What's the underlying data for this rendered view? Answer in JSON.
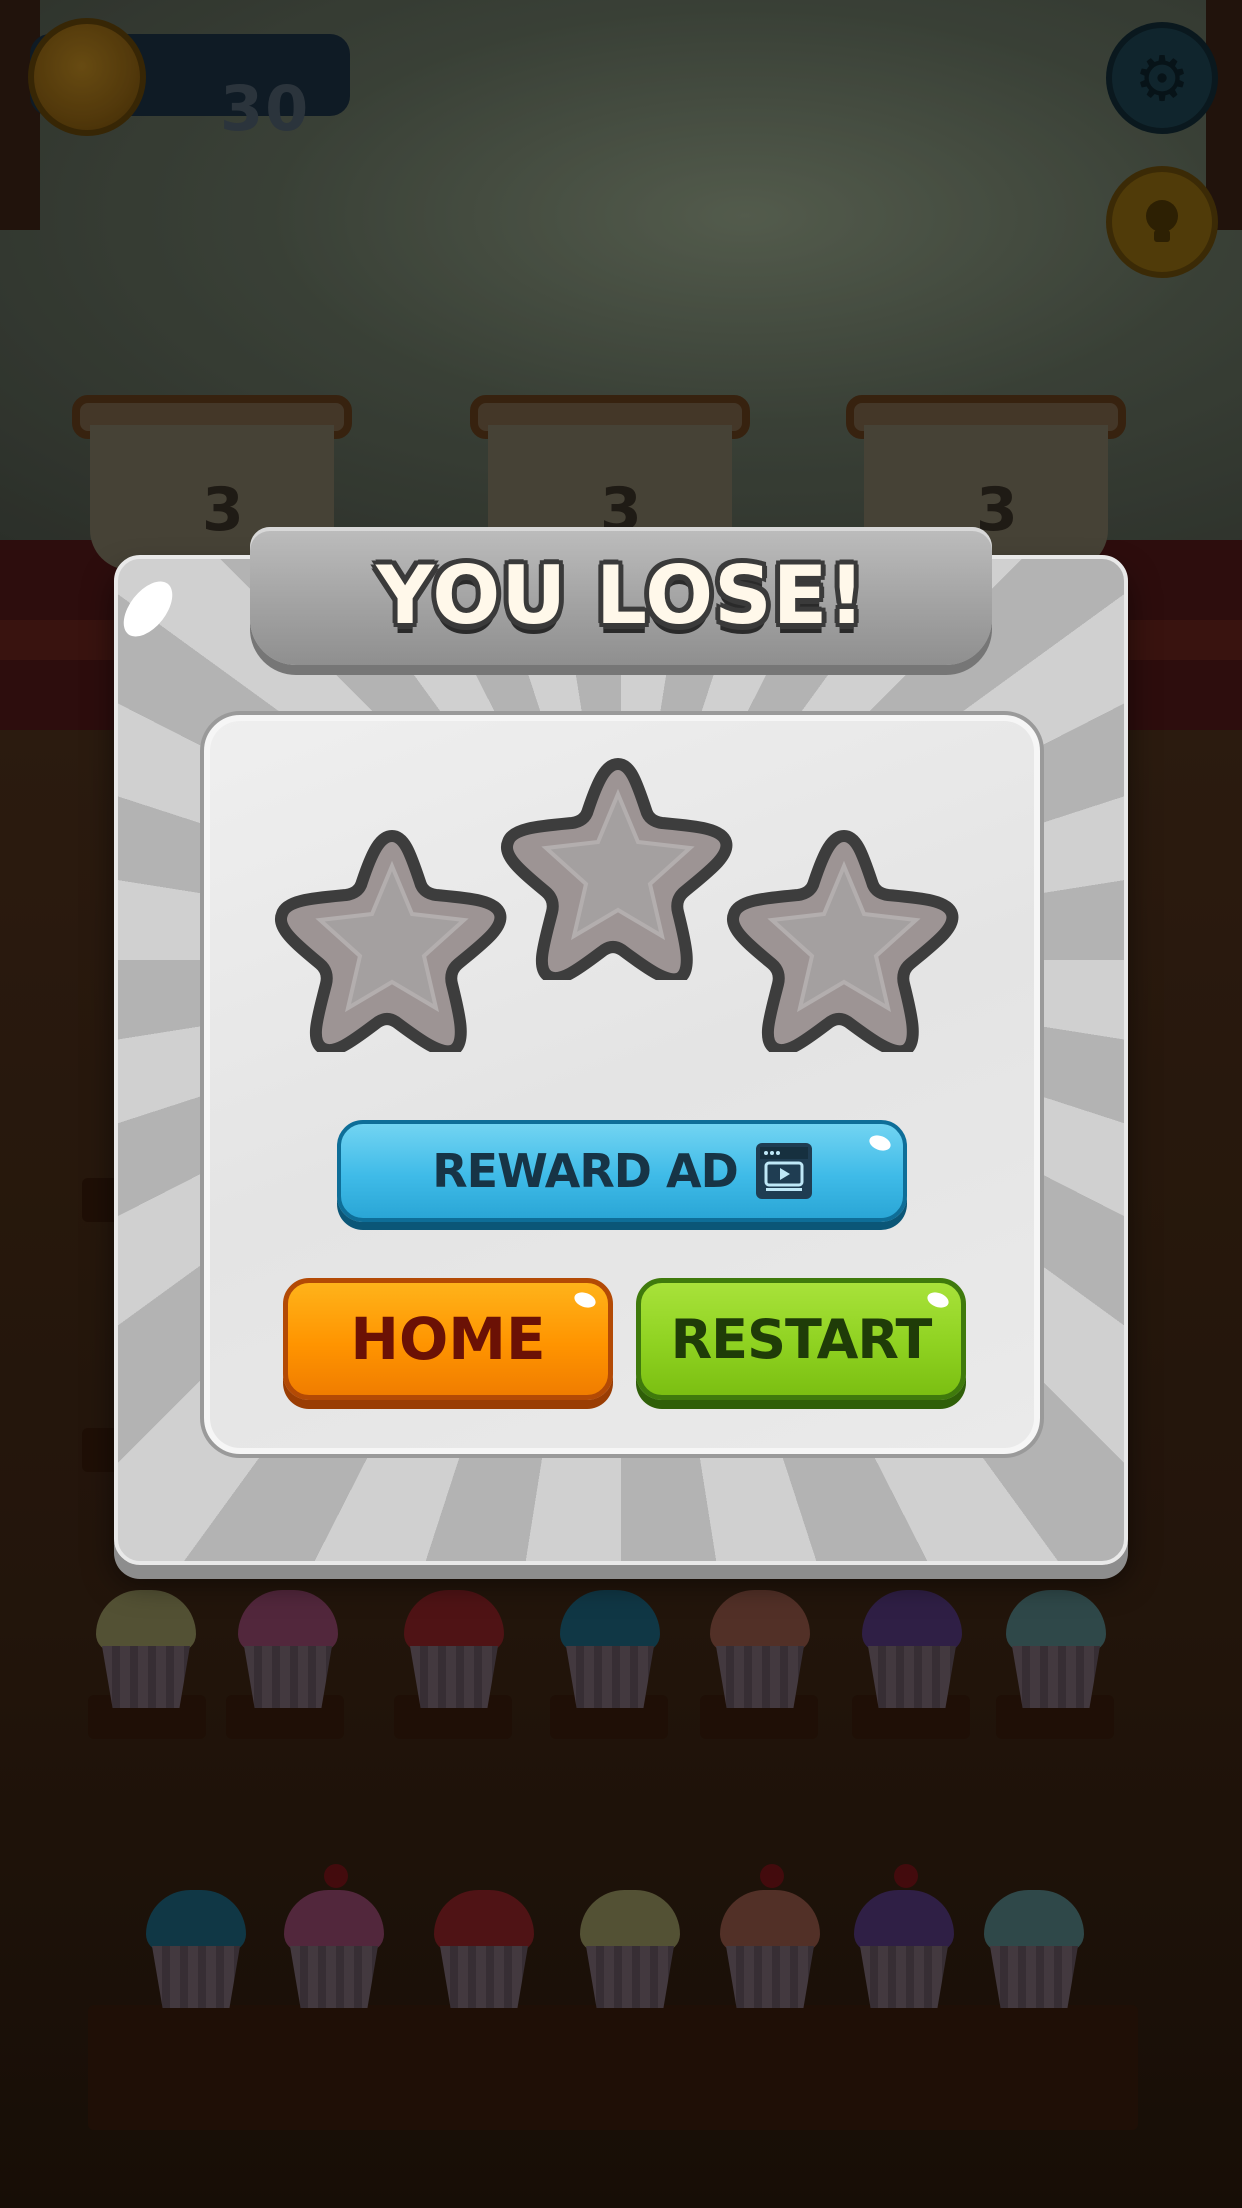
{
  "hud": {
    "coins": "30",
    "settings_icon": "gear-icon",
    "hint_icon": "lightbulb-icon"
  },
  "baskets": [
    {
      "count": "3"
    },
    {
      "count": "3"
    },
    {
      "count": "3"
    }
  ],
  "dialog": {
    "title": "YOU LOSE!",
    "stars_earned": 0,
    "stars_total": 3,
    "reward_button": {
      "label": "REWARD AD",
      "icon": "video-ad-icon"
    },
    "home_button": {
      "label": "HOME"
    },
    "restart_button": {
      "label": "RESTART"
    }
  },
  "colors": {
    "reward": "#3fbbe8",
    "home": "#ff9400",
    "restart": "#8fd221",
    "banner": "#a3a3a3"
  }
}
